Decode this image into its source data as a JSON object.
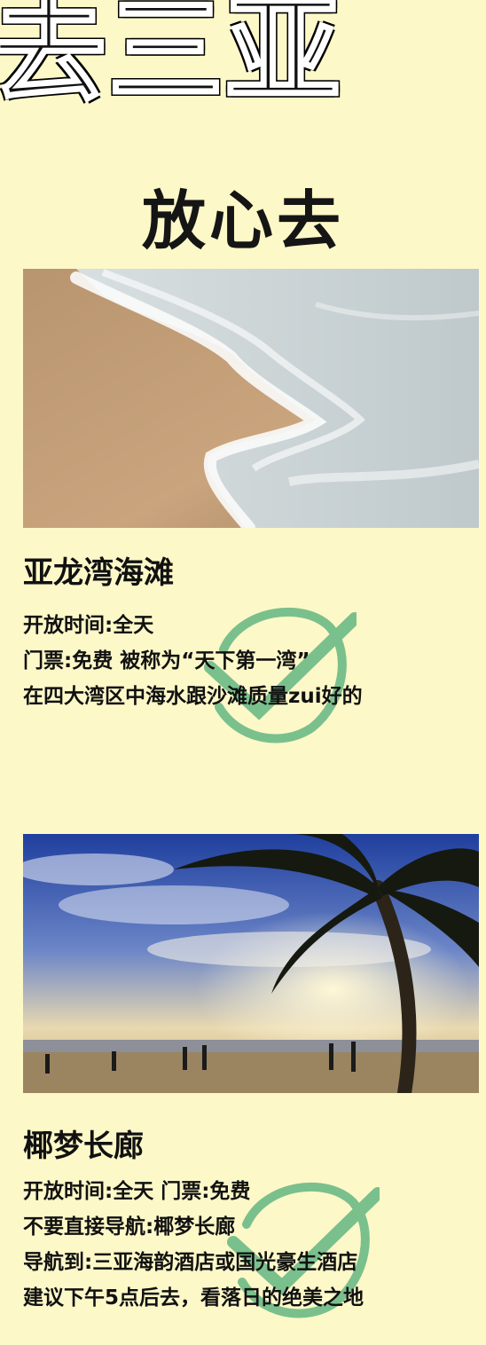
{
  "header": {
    "title": "去三亚",
    "subtitle": "放心去"
  },
  "spots": [
    {
      "name": "亚龙湾海滩",
      "lines": [
        "开放时间:全天",
        "门票:免费      被称为“天下第一湾”",
        "在四大湾区中海水跟沙滩质量zui好的"
      ],
      "image": "beach-waves-photo"
    },
    {
      "name": "椰梦长廊",
      "lines": [
        "开放时间:全天     门票:免费",
        "不要直接导航:椰梦长廊",
        "导航到:三亚海韵酒店或国光豪生酒店",
        "建议下午5点后去，看落日的绝美之地"
      ],
      "image": "palm-sunset-photo"
    }
  ],
  "colors": {
    "background": "#fdf8c8",
    "check": "#4fae7a"
  }
}
